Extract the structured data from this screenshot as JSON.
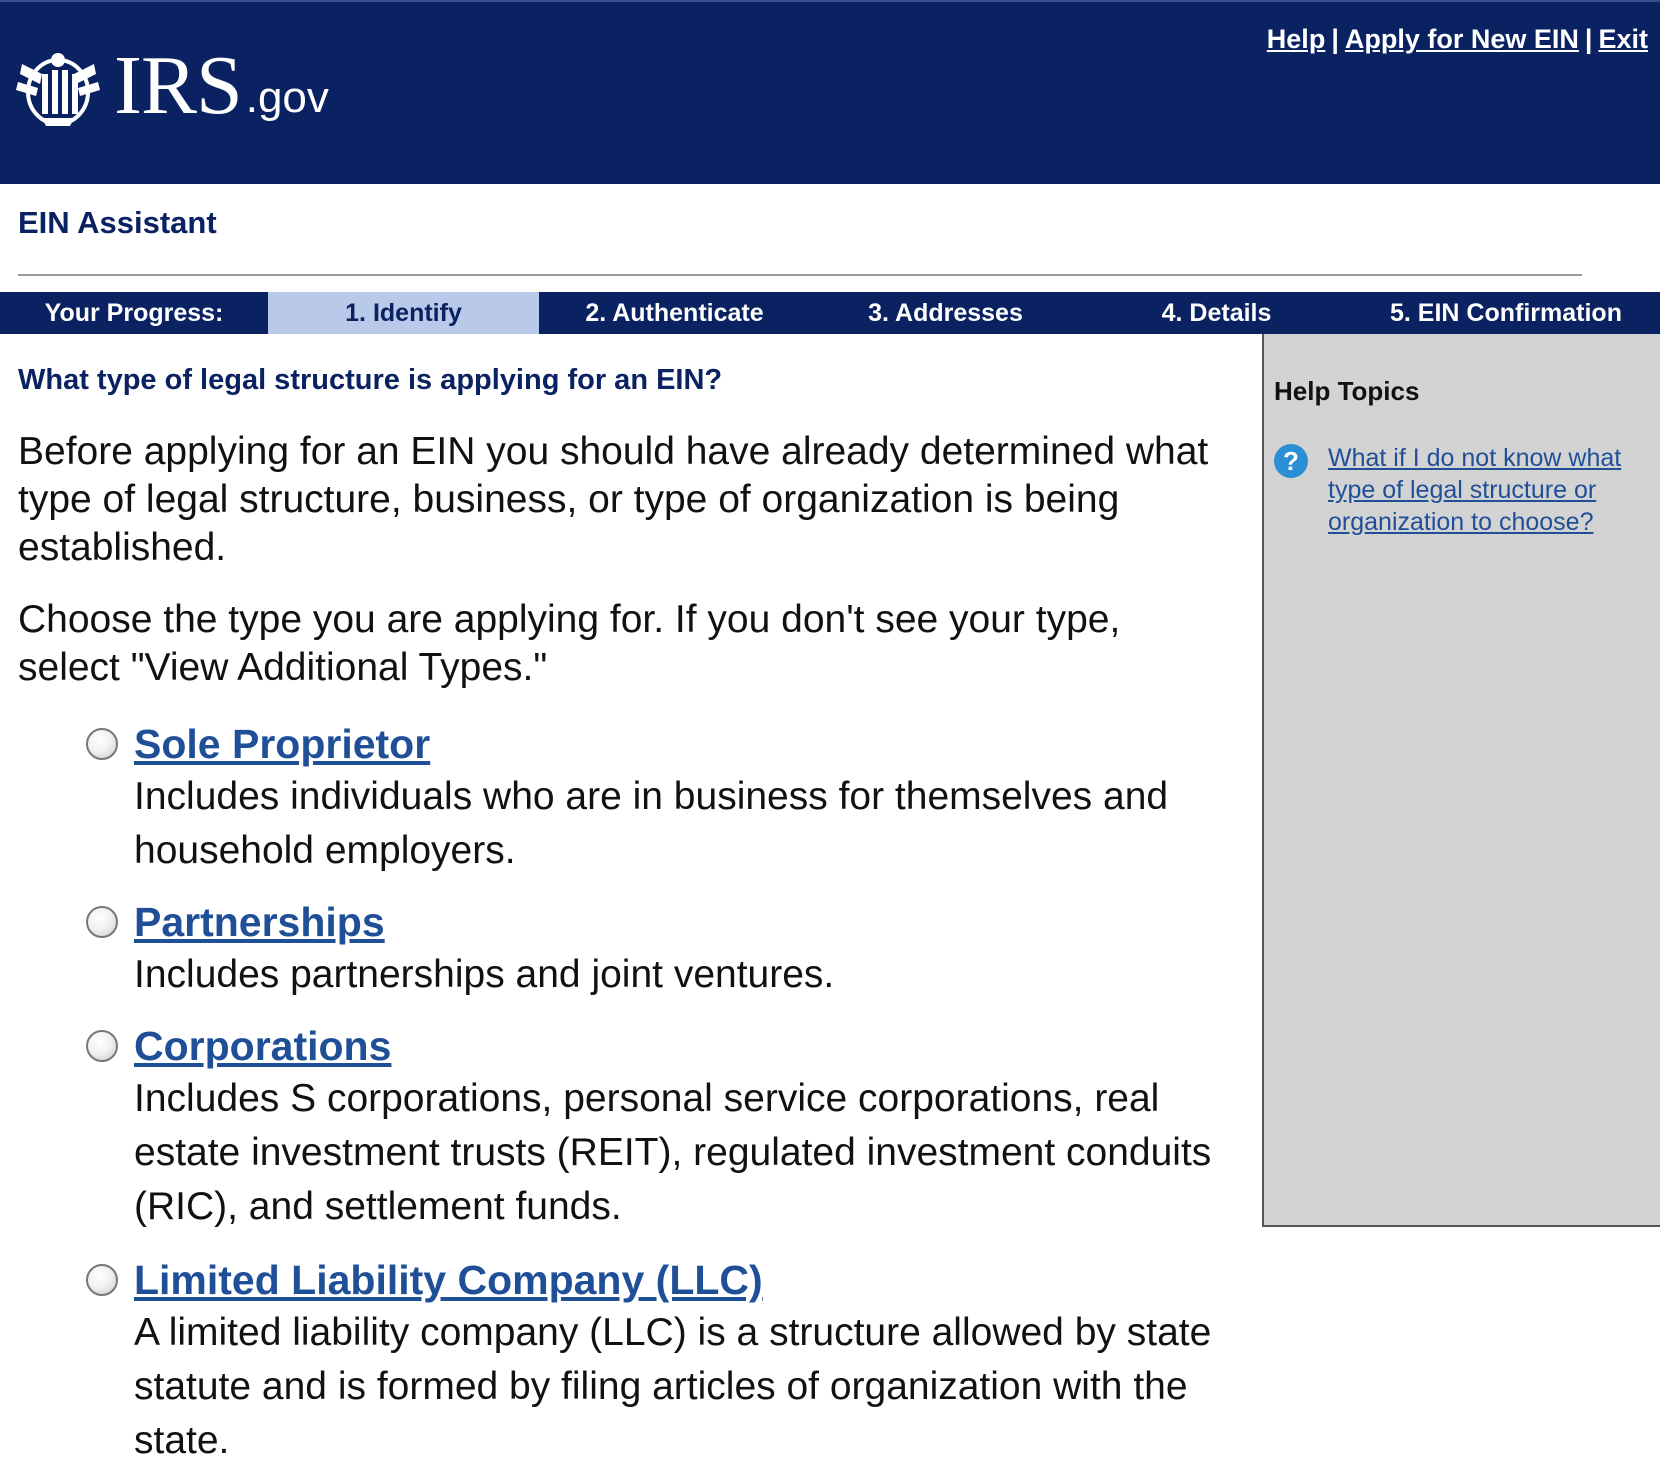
{
  "header": {
    "logo_text": "IRS",
    "logo_suffix": ".gov",
    "links": {
      "help": "Help",
      "apply_new": "Apply for New EIN",
      "exit": "Exit",
      "separator": "|"
    }
  },
  "assistant_title": "EIN Assistant",
  "progress": {
    "label": "Your Progress:",
    "steps": [
      "1. Identify",
      "2. Authenticate",
      "3. Addresses",
      "4. Details",
      "5. EIN Confirmation"
    ],
    "current_step": 1
  },
  "main": {
    "question": "What type of legal structure is applying for an EIN?",
    "intro": "Before applying for an EIN you should have already determined what type of legal structure, business, or type of organization is being established.",
    "instruction": "Choose the type you are applying for. If you don't see your type, select \"View Additional Types.\"",
    "options": [
      {
        "label": "Sole Proprietor",
        "description": "Includes individuals who are in business for themselves and household employers."
      },
      {
        "label": "Partnerships",
        "description": "Includes partnerships and joint ventures."
      },
      {
        "label": "Corporations",
        "description": "Includes S corporations, personal service corporations, real estate investment trusts (REIT), regulated investment conduits (RIC), and settlement funds."
      },
      {
        "label": "Limited Liability Company (LLC)",
        "description": "A limited liability company (LLC) is a structure allowed by state statute and is formed by filing articles of organization with the state."
      }
    ]
  },
  "sidebar": {
    "title": "Help Topics",
    "icon_glyph": "?",
    "topics": [
      {
        "label": "What if I do not know what type of legal structure or organization to choose?"
      }
    ]
  },
  "colors": {
    "header_bg": "#0b2262",
    "active_step_bg": "#b8c9ea",
    "link": "#1f4f97",
    "sidebar_bg": "#d3d3d3",
    "help_icon": "#2b8fd6"
  }
}
